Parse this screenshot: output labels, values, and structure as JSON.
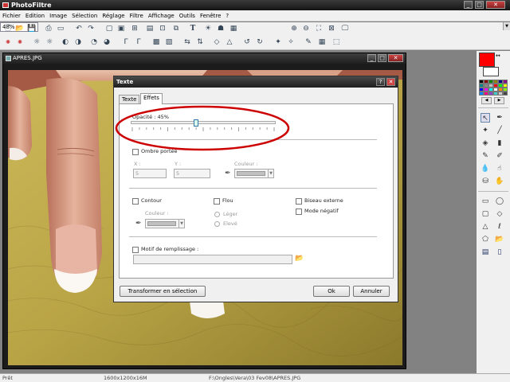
{
  "app": {
    "title": "PhotoFiltre"
  },
  "menu": [
    "Fichier",
    "Edition",
    "Image",
    "Sélection",
    "Réglage",
    "Filtre",
    "Affichage",
    "Outils",
    "Fenêtre",
    "?"
  ],
  "toolbar": {
    "zoom": "48%"
  },
  "image_window": {
    "title": "APRES.JPG"
  },
  "dialog": {
    "title": "Texte",
    "tabs": [
      "Texte",
      "Effets"
    ],
    "active_tab": "Effets",
    "opacity_label": "Opacité : 45%",
    "opacity_value": 0.45,
    "shadow_label": "Ombre portée",
    "x_label": "X :",
    "y_label": "Y :",
    "x_value": "5",
    "y_value": "5",
    "color_label": "Couleur :",
    "contour_label": "Contour",
    "contour_color_label": "Couleur :",
    "flou_label": "Flou",
    "leger_label": "Léger",
    "eleve_label": "Elevé",
    "biseau_label": "Biseau externe",
    "mode_negatif_label": "Mode négatif",
    "motif_label": "Motif de remplissage :",
    "transform_button": "Transformer en sélection",
    "ok_button": "Ok",
    "cancel_button": "Annuler"
  },
  "status": {
    "state": "Prêt",
    "dimensions": "1600x1200x16M",
    "path": "F:\\Ongles\\Vera\\03 Fev08\\APRES.JPG"
  },
  "colors": {
    "foreground": "#ff0000",
    "background": "#ffffff",
    "annotation_ellipse": "#cc0000"
  }
}
